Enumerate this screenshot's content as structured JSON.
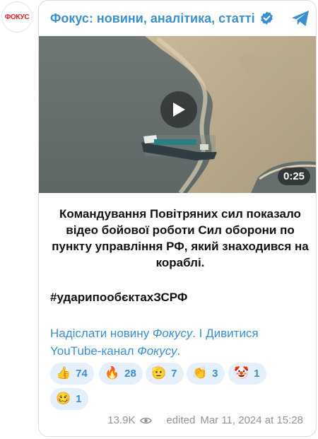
{
  "avatar": {
    "text": "ФОКУС",
    "color": "#e5202a"
  },
  "channel": {
    "name": "Фокус: новини, аналітика, статті",
    "verified_icon": "verified-check-icon",
    "share_icon": "telegram-plane-icon",
    "accent": "#3a8fd0"
  },
  "video": {
    "duration": "0:25",
    "play_icon": "play-icon"
  },
  "post": {
    "text": "Командування Повітряних сил показало відео бойової роботи Сил оборони по пункту управління РФ, який знаходився на кораблі.",
    "hashtag": "#ударипообєктахЗСРФ"
  },
  "links": {
    "part1": "Надіслати новину ",
    "part1_italic": "Фокусу",
    "separator": ". І ",
    "part2": "Дивитися YouTube-канал ",
    "part2_italic": "Фокусу",
    "end": "."
  },
  "reactions": [
    {
      "emoji": "👍",
      "count": "74"
    },
    {
      "emoji": "🔥",
      "count": "28"
    },
    {
      "emoji": "🫡",
      "count": "7"
    },
    {
      "emoji": "👏",
      "count": "3"
    },
    {
      "emoji": "🤡",
      "count": "1"
    },
    {
      "emoji": "🥴",
      "count": "1"
    }
  ],
  "meta": {
    "views": "13.9K",
    "views_icon": "eye-icon",
    "edited": "edited",
    "date": "Mar 11, 2024 at 15:28"
  }
}
